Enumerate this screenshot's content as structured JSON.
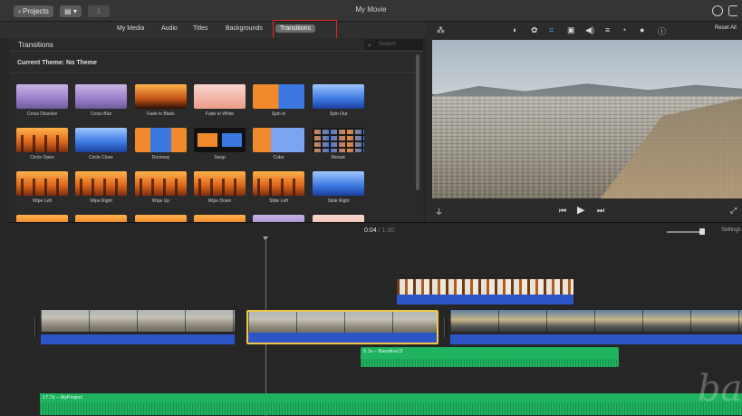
{
  "titlebar": {
    "back_label": "Projects",
    "layout_glyph": "▤ ▾",
    "import_glyph": "⇩",
    "window_title": "My Movie"
  },
  "tabs": [
    {
      "label": "My Media"
    },
    {
      "label": "Audio"
    },
    {
      "label": "Titles"
    },
    {
      "label": "Backgrounds"
    },
    {
      "label": "Transitions",
      "active": true
    }
  ],
  "browser": {
    "title": "Transitions",
    "search_placeholder": "Search",
    "theme_label": "Current Theme: No Theme",
    "transitions": [
      {
        "label": "Cross Dissolve",
        "style": "t-purple"
      },
      {
        "label": "Cross Blur",
        "style": "t-purple"
      },
      {
        "label": "Fade to Black",
        "style": "t-black"
      },
      {
        "label": "Fade to White",
        "style": "t-pink"
      },
      {
        "label": "Spin In",
        "style": "t-split2"
      },
      {
        "label": "Spin Out",
        "style": "t-blue"
      },
      {
        "label": "Circle Open",
        "style": "t-forest"
      },
      {
        "label": "Circle Close",
        "style": "t-blue"
      },
      {
        "label": "Doorway",
        "style": "t-door"
      },
      {
        "label": "Swap",
        "style": "t-swap"
      },
      {
        "label": "Cube",
        "style": "t-cube"
      },
      {
        "label": "Mosaic",
        "style": "t-mosaic"
      },
      {
        "label": "Wipe Left",
        "style": "t-forest"
      },
      {
        "label": "Wipe Right",
        "style": "t-forest"
      },
      {
        "label": "Wipe Up",
        "style": "t-forest"
      },
      {
        "label": "Wipe Down",
        "style": "t-forest"
      },
      {
        "label": "Slide Left",
        "style": "t-forest"
      },
      {
        "label": "Slide Right",
        "style": "t-blue"
      },
      {
        "label": "",
        "style": "t-forest"
      },
      {
        "label": "",
        "style": "t-forest"
      },
      {
        "label": "",
        "style": "t-forest"
      },
      {
        "label": "",
        "style": "t-forest"
      },
      {
        "label": "",
        "style": "t-purple"
      },
      {
        "label": "",
        "style": "t-pink"
      }
    ]
  },
  "viewer": {
    "reset_label": "Reset All",
    "tool_icons": [
      "magic-wand-icon",
      "color-balance-icon",
      "color-correction-icon",
      "crop-icon",
      "stabilization-icon",
      "volume-icon",
      "noise-reduction-icon",
      "speed-icon",
      "filter-icon",
      "info-icon"
    ]
  },
  "timeline": {
    "current_time": "0:04",
    "separator": "/",
    "total_time": "1:30",
    "settings_label": "Settings",
    "clips": [
      {
        "name": "clip-1"
      },
      {
        "name": "clip-2-selected"
      },
      {
        "name": "clip-3"
      },
      {
        "name": "cutaway-clip"
      }
    ],
    "audio_clip_label": "5.1s – Bassline12",
    "music_label": "17.7s – MyProject"
  },
  "colors": {
    "selection_outline": "#f1c74a",
    "audio_blue": "#2d55c6",
    "music_green": "#1fb25f",
    "highlight_red": "#e02525"
  }
}
